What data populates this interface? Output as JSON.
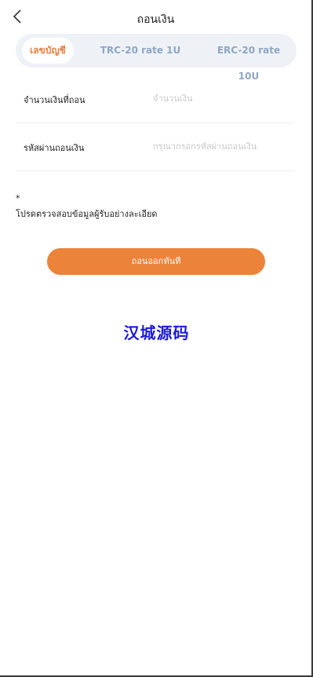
{
  "header": {
    "title": "ถอนเงิน",
    "back_icon": "chevron-left-icon"
  },
  "tabs": [
    {
      "label": "เลขบัญชี",
      "active": true
    },
    {
      "label": "TRC-20 rate 1U",
      "active": false
    },
    {
      "label": "ERC-20 rate 10U",
      "active": false
    }
  ],
  "form": {
    "amount": {
      "label": "จำนวนเงินที่ถอน",
      "placeholder": "จำนวนเงิน",
      "value": ""
    },
    "password": {
      "label": "รหัสผ่านถอนเงิน",
      "placeholder": "กรุณากรอกรหัสผ่านถอนเงิน",
      "value": ""
    }
  },
  "note": {
    "star": "*",
    "text": "โปรดตรวจสอบข้อมูลผู้รับอย่างละเอียด"
  },
  "submit_label": "ถอนออกทันที",
  "watermark": "汉城源码",
  "colors": {
    "accent": "#eb833b",
    "tab_inactive": "#8fa6c4",
    "tab_bg": "#eef2f7",
    "watermark": "#1c1ad6"
  }
}
